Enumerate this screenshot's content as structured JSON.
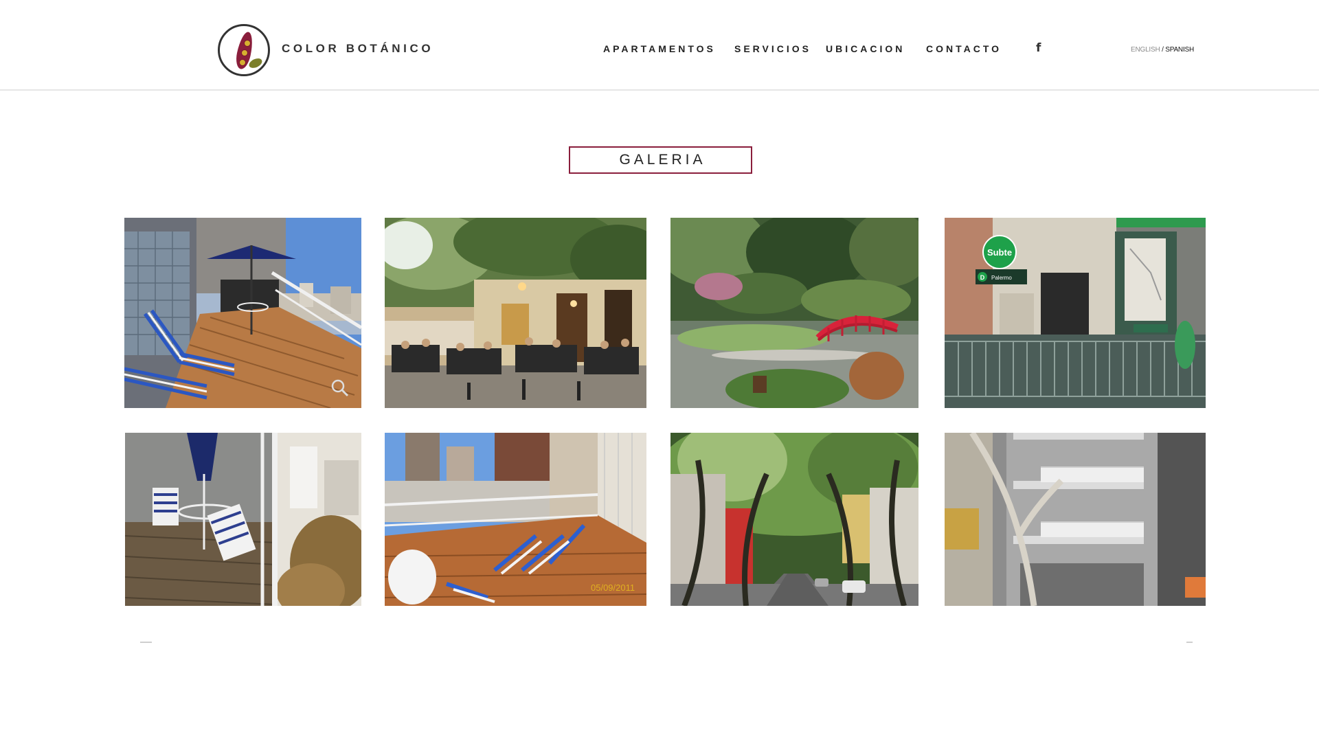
{
  "header": {
    "brand": "COLOR BOTÁNICO",
    "nav": [
      {
        "label": "APARTAMENTOS"
      },
      {
        "label": "SERVICIOS"
      },
      {
        "label": "UBICACION"
      },
      {
        "label": "CONTACTO"
      }
    ],
    "facebook_glyph": "f",
    "lang": {
      "english": "ENGLISH",
      "separator": " / ",
      "spanish": "SPANISH"
    }
  },
  "gallery": {
    "title": "GALERIA",
    "items": [
      {
        "scene": "rooftop-terrace-umbrella"
      },
      {
        "scene": "street-cafe"
      },
      {
        "scene": "japanese-garden-bridge"
      },
      {
        "scene": "subte-station-entrance"
      },
      {
        "scene": "balcony-chairs"
      },
      {
        "scene": "terrace-loungers"
      },
      {
        "scene": "tree-lined-street"
      },
      {
        "scene": "building-facade"
      }
    ],
    "photo_date_stamp": "05/09/2011",
    "subte_sign": "Subte",
    "subte_line": "D",
    "subte_station": "Palermo"
  },
  "colors": {
    "accent": "#8a1e3c",
    "text": "#222222",
    "divider": "#e6e6e6"
  },
  "icons": {
    "logo": "leaf-seeds-logo",
    "facebook": "facebook-icon",
    "zoom": "magnifier-icon"
  }
}
